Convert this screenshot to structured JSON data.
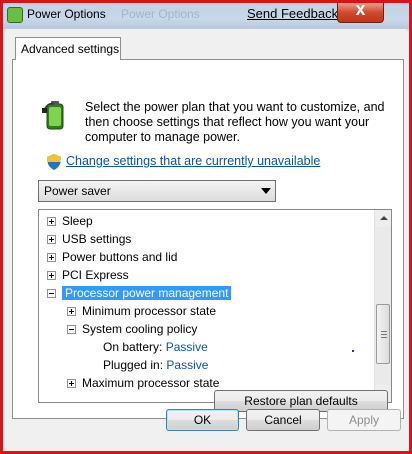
{
  "window": {
    "title": "Power Options",
    "feedback_link": "Send Feedback",
    "close_glyph": "X",
    "background_ghost_text": "Power Options"
  },
  "tabs": [
    {
      "label": "Advanced settings",
      "active": true
    }
  ],
  "intro": {
    "text": "Select the power plan that you want to customize, and then choose settings that reflect how you want your computer to manage power.",
    "icon": "battery-power-icon"
  },
  "change_link": {
    "icon": "uac-shield-icon",
    "label": "Change settings that are currently unavailable"
  },
  "plan_dropdown": {
    "selected": "Power saver"
  },
  "settings_tree": {
    "items": [
      {
        "label": "Sleep",
        "expander": "plus",
        "indent": 0
      },
      {
        "label": "USB settings",
        "expander": "plus",
        "indent": 0
      },
      {
        "label": "Power buttons and lid",
        "expander": "plus",
        "indent": 0
      },
      {
        "label": "PCI Express",
        "expander": "plus",
        "indent": 0
      },
      {
        "label": "Processor power management",
        "expander": "minus",
        "indent": 0,
        "selected": true
      },
      {
        "label": "Minimum processor state",
        "expander": "plus",
        "indent": 1
      },
      {
        "label": "System cooling policy",
        "expander": "minus",
        "indent": 1
      },
      {
        "label": "On battery:",
        "value": "Passive",
        "indent": 2
      },
      {
        "label": "Plugged in:",
        "value": "Passive",
        "indent": 2
      },
      {
        "label": "Maximum processor state",
        "expander": "plus",
        "indent": 1
      }
    ]
  },
  "buttons": {
    "restore": "Restore plan defaults",
    "ok": "OK",
    "cancel": "Cancel",
    "apply": "Apply"
  },
  "colors": {
    "selection": "#3399ff",
    "link": "#0a53a8",
    "frame_highlight": "#d4161b"
  }
}
